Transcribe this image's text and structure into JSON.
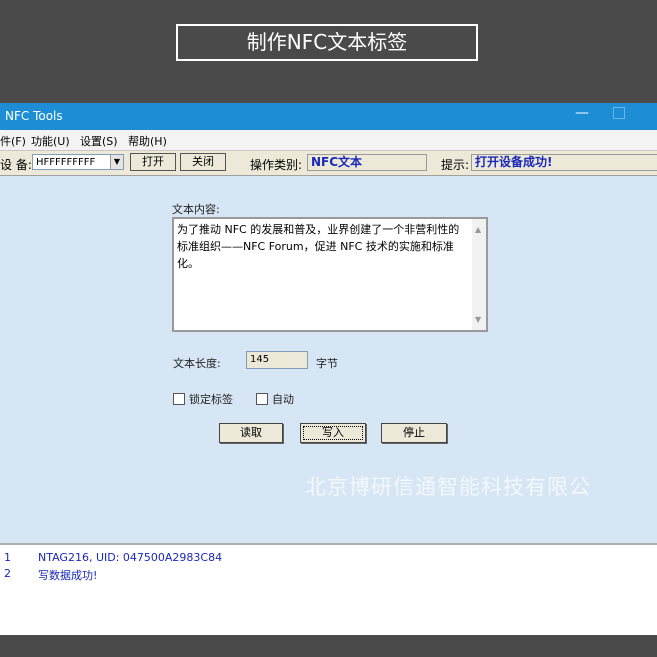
{
  "banner": {
    "title": "制作NFC文本标签"
  },
  "window": {
    "title": "NFC Tools"
  },
  "menu": {
    "items": [
      "件(F)",
      "功能(U)",
      "设置(S)",
      "帮助(H)"
    ]
  },
  "toolbar": {
    "device_label": "设 备:",
    "device_value": "HFFFFFFFFF",
    "open_label": "打开",
    "close_label": "关闭",
    "op_type_label": "操作类别:",
    "op_type_value": "NFC文本",
    "hint_label": "提示:",
    "hint_value": "打开设备成功!"
  },
  "form": {
    "text_content_label": "文本内容:",
    "text_content": "为了推动 NFC 的发展和普及，业界创建了一个非营利性的标准组织——NFC Forum，促进 NFC 技术的实施和标准化。",
    "length_label": "文本长度:",
    "length_value": "145",
    "length_unit": "字节",
    "lock_label": "锁定标签",
    "auto_label": "自动",
    "read_label": "读取",
    "write_label": "写入",
    "stop_label": "停止"
  },
  "watermark": "北京博研信通智能科技有限公",
  "log": [
    {
      "num": "1",
      "text": "NTAG216, UID: 047500A2983C84"
    },
    {
      "num": "2",
      "text": "写数据成功!"
    }
  ]
}
